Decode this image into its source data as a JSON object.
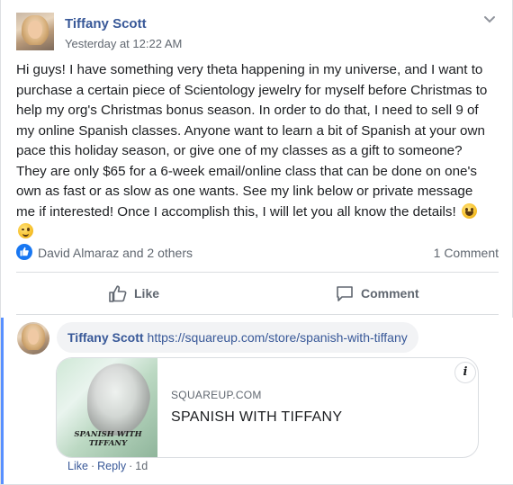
{
  "post": {
    "author": "Tiffany Scott",
    "timestamp": "Yesterday at 12:22 AM",
    "text": "Hi guys! I have something very theta happening in my universe, and I want to purchase a certain piece of Scientology jewelry for myself before Christmas to help my org's Christmas bonus season. In order to do that, I need to sell 9 of my online Spanish classes. Anyone want to learn a bit of Spanish at your own pace this holiday season, or give one of my classes as a gift to someone? They are only $65 for a 6-week email/online class that can be done on one's own as fast or as slow as one wants. See my link below or private message me if interested! Once I accomplish this, I will let you all know the details!",
    "emojis": [
      "grinning-face",
      "winking-face"
    ]
  },
  "reactions": {
    "reactors": "David Almaraz and 2 others",
    "comments_count": "1 Comment"
  },
  "actions": {
    "like_label": "Like",
    "comment_label": "Comment"
  },
  "comment": {
    "author": "Tiffany Scott",
    "link_text": "https://squareup.com/store/spanish-with-tiffany",
    "preview": {
      "domain": "SQUAREUP.COM",
      "title": "SPANISH WITH TIFFANY",
      "thumbnail_text": "SPANISH WITH TIFFANY",
      "info_glyph": "i"
    },
    "like_label": "Like",
    "reply_label": "Reply",
    "age": "1d"
  },
  "colors": {
    "link_blue": "#385898",
    "like_blue": "#1877f2",
    "comment_accent": "#5890ff",
    "muted": "#606770"
  }
}
